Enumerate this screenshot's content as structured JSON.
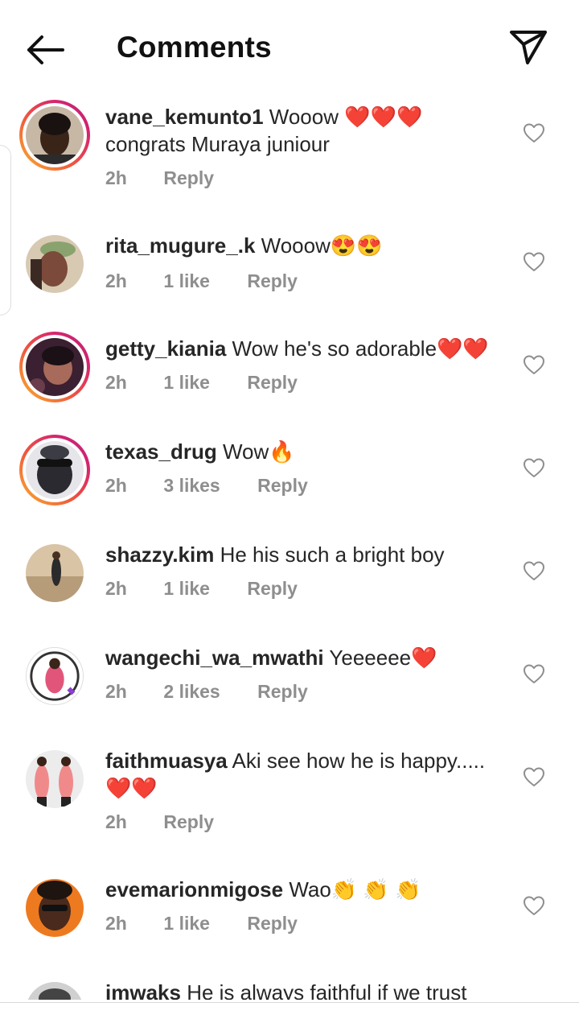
{
  "header": {
    "title": "Comments",
    "back_icon": "back-arrow-icon",
    "send_icon": "send-paper-plane-icon"
  },
  "reply_label": "Reply",
  "comments": [
    {
      "username": "vane_kemunto1",
      "text": "Wooow ❤️❤️❤️ congrats  Muraya juniour",
      "time": "2h",
      "likes": "",
      "story_ring": true
    },
    {
      "username": "rita_mugure_.k",
      "text": "Wooow😍😍",
      "time": "2h",
      "likes": "1 like",
      "story_ring": false
    },
    {
      "username": "getty_kiania",
      "text": "Wow he's so adorable❤️❤️",
      "time": "2h",
      "likes": "1 like",
      "story_ring": true
    },
    {
      "username": "texas_drug",
      "text": "Wow🔥",
      "time": "2h",
      "likes": "3 likes",
      "story_ring": true
    },
    {
      "username": "shazzy.kim",
      "text": "He his such a bright boy",
      "time": "2h",
      "likes": "1 like",
      "story_ring": false
    },
    {
      "username": "wangechi_wa_mwathi",
      "text": "Yeeeeee❤️",
      "time": "2h",
      "likes": "2 likes",
      "story_ring": false
    },
    {
      "username": "faithmuasya",
      "text": "Aki see how he is happy..... ❤️❤️",
      "time": "2h",
      "likes": "",
      "story_ring": false
    },
    {
      "username": "evemarionmigose",
      "text": "Wao👏 👏 👏",
      "time": "2h",
      "likes": "1 like",
      "story_ring": false
    },
    {
      "username": "imwaks",
      "text": "He is always faithful if we trust",
      "time": "",
      "likes": "",
      "story_ring": false
    }
  ],
  "colors": {
    "text": "#262626",
    "meta": "#8e8e8e",
    "heart_red": "#e0141e",
    "ring_start": "#f9b42f",
    "ring_end": "#b8267c"
  }
}
